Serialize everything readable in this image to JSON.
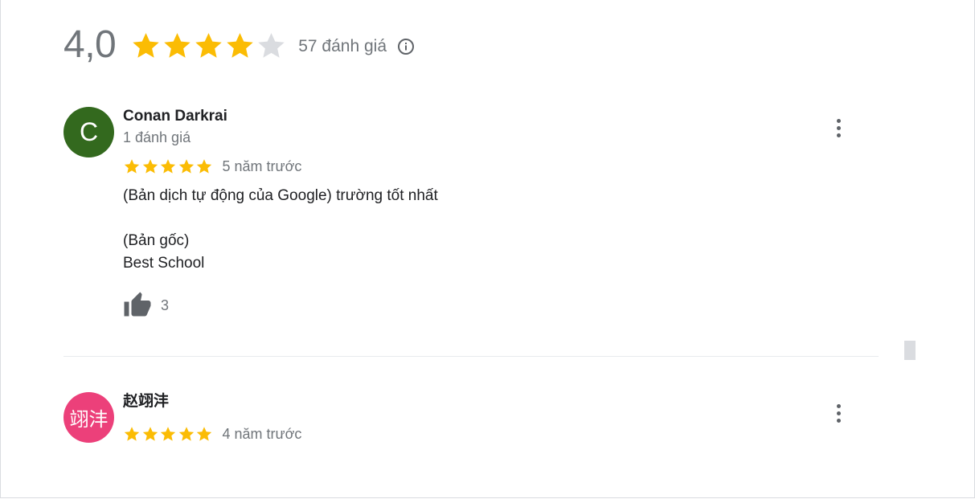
{
  "summary": {
    "score": "4,0",
    "rating": 4,
    "max_rating": 5,
    "review_count": "57 đánh giá",
    "info_icon": "info-icon"
  },
  "colors": {
    "star_filled": "#fbbc04",
    "star_empty": "#dadce0",
    "muted_text": "#70757a"
  },
  "reviews": [
    {
      "avatar_letter": "C",
      "avatar_color": "#33691e",
      "name": "Conan Darkrai",
      "sub": "1 đánh giá",
      "rating": 5,
      "time": "5 năm trước",
      "text_line1": "(Bản dịch tự động của Google) trường tốt nhất",
      "text_line2": "(Bản gốc)",
      "text_line3": "Best School",
      "likes": "3"
    },
    {
      "avatar_letter": "翊沣",
      "avatar_color": "#ec407a",
      "name": "赵翊沣",
      "rating": 5,
      "time": "4 năm trước"
    }
  ]
}
